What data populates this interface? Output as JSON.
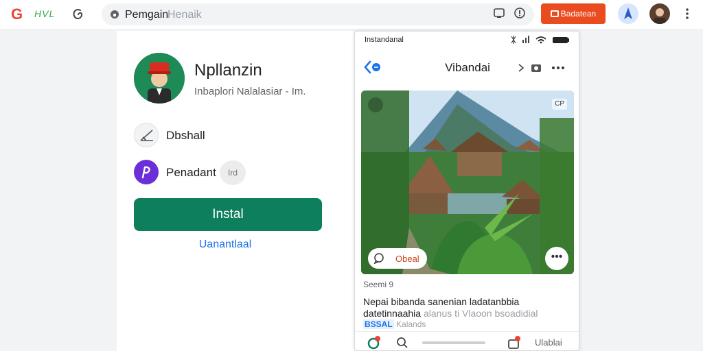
{
  "browser": {
    "brand_text": "HVL",
    "url_host": "Pemgain",
    "url_path": "Henaik",
    "action_button": "Badatean",
    "icons": [
      "g-logo",
      "swirl-icon",
      "lock-icon",
      "cast-icon",
      "info-icon",
      "navigation-avatar-icon",
      "user-avatar",
      "kebab-menu-icon"
    ]
  },
  "app": {
    "name": "Npllanzin",
    "subtitle": "Inbaplori Nalalasiar - Im.",
    "rows": [
      {
        "icon": "pencil-icon",
        "label": "Dbshall"
      },
      {
        "icon": "p-logo-icon",
        "label": "Penadant",
        "chip": "Ird"
      }
    ],
    "install_label": "Instal",
    "secondary_link": "Uanantlaal",
    "accent_color": "#0e7f5d"
  },
  "phone": {
    "status_title": "Instandanal",
    "header_title": "Vibandai",
    "photo_badge": "CP",
    "comment_label": "Obeal",
    "caption_meta": "Seemi 9",
    "caption_line1": "Nepai bibanda sanenian ladatanbbia",
    "caption_line2a": "datetinnaahia",
    "caption_line2b": "alanus ti Vlaoon bsoadidial",
    "caption_tag": "BSSAL",
    "caption_line3": "Kalands",
    "tab_label": "Ulablai",
    "badge_color": "#ea4335"
  }
}
